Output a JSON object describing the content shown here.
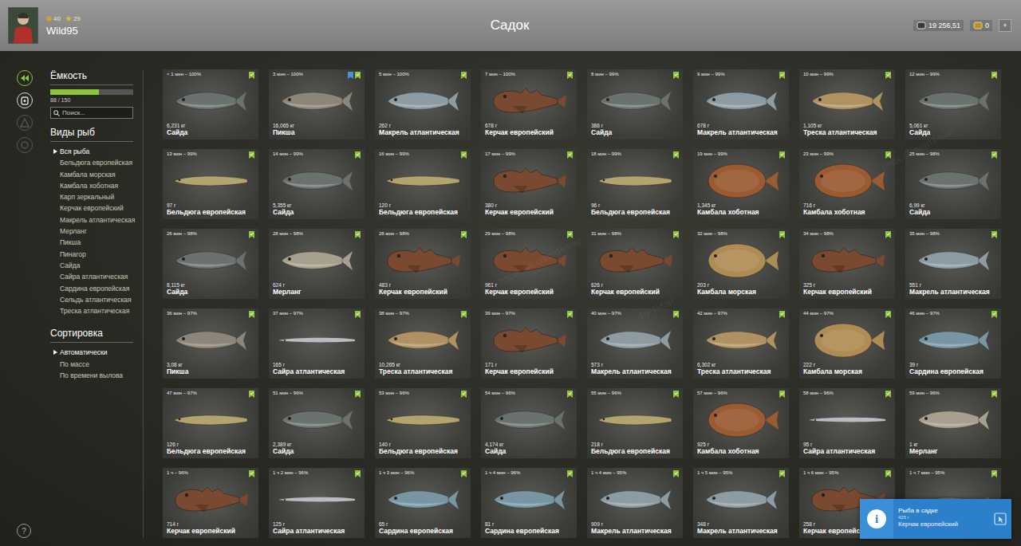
{
  "header": {
    "title": "Садок",
    "player": {
      "name": "Wild95",
      "level": "40",
      "stars": "29"
    },
    "money": "19 256,51",
    "gold": "0",
    "add_button": "+"
  },
  "side_icons": [
    {
      "selected": true
    },
    {
      "selected": false
    },
    {
      "selected": false
    },
    {
      "selected": false
    }
  ],
  "capacity": {
    "title": "Ёмкость",
    "reading": "88 / 150",
    "level": 0.587
  },
  "search": {
    "placeholder": "Поиск..."
  },
  "species": {
    "title": "Виды рыб",
    "items": [
      {
        "label": "Вся рыба",
        "selected": true
      },
      {
        "label": "Бельдюга европейская",
        "selected": false
      },
      {
        "label": "Камбала морская",
        "selected": false
      },
      {
        "label": "Камбала хоботная",
        "selected": false
      },
      {
        "label": "Карп зеркальный",
        "selected": false
      },
      {
        "label": "Керчак европейский",
        "selected": false
      },
      {
        "label": "Макрель атлантическая",
        "selected": false
      },
      {
        "label": "Мерланг",
        "selected": false
      },
      {
        "label": "Пикша",
        "selected": false
      },
      {
        "label": "Пинагор",
        "selected": false
      },
      {
        "label": "Сайда",
        "selected": false
      },
      {
        "label": "Сайра атлантическая",
        "selected": false
      },
      {
        "label": "Сардина европейская",
        "selected": false
      },
      {
        "label": "Сельдь атлантическая",
        "selected": false
      },
      {
        "label": "Треска атлантическая",
        "selected": false
      }
    ]
  },
  "sorting": {
    "title": "Сортировка",
    "items": [
      {
        "label": "Автоматически",
        "selected": true
      },
      {
        "label": "По массе",
        "selected": false
      },
      {
        "label": "По времени вылова",
        "selected": false
      }
    ]
  },
  "help": "?",
  "cards": [
    {
      "time": "< 1 мин – 100%",
      "weight": "6,231 кг",
      "name": "Сайда",
      "kind": "roundfish",
      "color": "#6b716f",
      "checked": true,
      "tagged": false
    },
    {
      "time": "3 мин – 100%",
      "weight": "16,065 кг",
      "name": "Пикша",
      "kind": "roundfish",
      "color": "#8c8579",
      "checked": true,
      "tagged": true
    },
    {
      "time": "5 мин – 100%",
      "weight": "262 г",
      "name": "Макрель атлантическая",
      "kind": "roundfish",
      "color": "#8c9ca2",
      "checked": true,
      "tagged": false
    },
    {
      "time": "7 мин – 100%",
      "weight": "678 г",
      "name": "Керчак европейский",
      "kind": "sculpin",
      "color": "#7a4a30",
      "checked": true,
      "tagged": false
    },
    {
      "time": "8 мин – 99%",
      "weight": "386 г",
      "name": "Сайда",
      "kind": "roundfish",
      "color": "#6b716f",
      "checked": true,
      "tagged": false
    },
    {
      "time": "9 мин – 99%",
      "weight": "678 г",
      "name": "Макрель атлантическая",
      "kind": "roundfish",
      "color": "#8c9ca2",
      "checked": true,
      "tagged": false
    },
    {
      "time": "10 мин – 99%",
      "weight": "1,105 кг",
      "name": "Треска атлантическая",
      "kind": "roundfish",
      "color": "#b09262",
      "checked": true,
      "tagged": false
    },
    {
      "time": "12 мин – 99%",
      "weight": "5,061 кг",
      "name": "Сайда",
      "kind": "roundfish",
      "color": "#6b716f",
      "checked": true,
      "tagged": false
    },
    {
      "time": "13 мин – 99%",
      "weight": "97 г",
      "name": "Бельдюга европейская",
      "kind": "eel",
      "color": "#b3a36e",
      "checked": true,
      "tagged": false
    },
    {
      "time": "14 мин – 99%",
      "weight": "5,355 кг",
      "name": "Сайда",
      "kind": "roundfish",
      "color": "#6b716f",
      "checked": true,
      "tagged": false
    },
    {
      "time": "16 мин – 99%",
      "weight": "120 г",
      "name": "Бельдюга европейская",
      "kind": "eel",
      "color": "#b3a36e",
      "checked": true,
      "tagged": false
    },
    {
      "time": "17 мин – 99%",
      "weight": "380 г",
      "name": "Керчак европейский",
      "kind": "sculpin",
      "color": "#7a4a30",
      "checked": true,
      "tagged": false
    },
    {
      "time": "18 мин – 99%",
      "weight": "96 г",
      "name": "Бельдюга европейская",
      "kind": "eel",
      "color": "#b3a36e",
      "checked": true,
      "tagged": false
    },
    {
      "time": "19 мин – 99%",
      "weight": "1,345 кг",
      "name": "Камбала хоботная",
      "kind": "flatfish",
      "color": "#9a5a32",
      "checked": true,
      "tagged": false
    },
    {
      "time": "23 мин – 99%",
      "weight": "716 г",
      "name": "Камбала хоботная",
      "kind": "flatfish",
      "color": "#9a5a32",
      "checked": true,
      "tagged": false
    },
    {
      "time": "25 мин – 98%",
      "weight": "6,99 кг",
      "name": "Сайда",
      "kind": "roundfish",
      "color": "#6b716f",
      "checked": true,
      "tagged": false
    },
    {
      "time": "26 мин – 98%",
      "weight": "8,115 кг",
      "name": "Сайда",
      "kind": "roundfish",
      "color": "#6b716f",
      "checked": true,
      "tagged": false
    },
    {
      "time": "28 мин – 98%",
      "weight": "624 г",
      "name": "Мерланг",
      "kind": "roundfish",
      "color": "#a8a08e",
      "checked": true,
      "tagged": false
    },
    {
      "time": "28 мин – 98%",
      "weight": "483 г",
      "name": "Керчак европейский",
      "kind": "sculpin",
      "color": "#7a4a30",
      "checked": true,
      "tagged": false
    },
    {
      "time": "29 мин – 98%",
      "weight": "961 г",
      "name": "Керчак европейский",
      "kind": "sculpin",
      "color": "#7a4a30",
      "checked": true,
      "tagged": false
    },
    {
      "time": "31 мин – 98%",
      "weight": "626 г",
      "name": "Керчак европейский",
      "kind": "sculpin",
      "color": "#7a4a30",
      "checked": true,
      "tagged": false
    },
    {
      "time": "32 мин – 98%",
      "weight": "203 г",
      "name": "Камбала морская",
      "kind": "flatfish",
      "color": "#b08c55",
      "checked": true,
      "tagged": false
    },
    {
      "time": "34 мин – 98%",
      "weight": "325 г",
      "name": "Керчак европейский",
      "kind": "sculpin",
      "color": "#7a4a30",
      "checked": true,
      "tagged": false
    },
    {
      "time": "35 мин – 98%",
      "weight": "551 г",
      "name": "Макрель атлантическая",
      "kind": "roundfish",
      "color": "#8c9ca2",
      "checked": true,
      "tagged": false
    },
    {
      "time": "36 мин – 97%",
      "weight": "3,08 кг",
      "name": "Пикша",
      "kind": "roundfish",
      "color": "#8c8579",
      "checked": true,
      "tagged": false
    },
    {
      "time": "37 мин – 97%",
      "weight": "165 г",
      "name": "Сайра атлантическая",
      "kind": "needle",
      "color": "#b9bdc2",
      "checked": true,
      "tagged": false
    },
    {
      "time": "38 мин – 97%",
      "weight": "10,265 кг",
      "name": "Треска атлантическая",
      "kind": "roundfish",
      "color": "#b09262",
      "checked": true,
      "tagged": false
    },
    {
      "time": "39 мин – 97%",
      "weight": "171 г",
      "name": "Керчак европейский",
      "kind": "sculpin",
      "color": "#7a4a30",
      "checked": true,
      "tagged": false
    },
    {
      "time": "40 мин – 97%",
      "weight": "573 г",
      "name": "Макрель атлантическая",
      "kind": "roundfish",
      "color": "#8c9ca2",
      "checked": true,
      "tagged": false
    },
    {
      "time": "42 мин – 97%",
      "weight": "6,302 кг",
      "name": "Треска атлантическая",
      "kind": "roundfish",
      "color": "#b09262",
      "checked": true,
      "tagged": false
    },
    {
      "time": "44 мин – 97%",
      "weight": "222 г",
      "name": "Камбала морская",
      "kind": "flatfish",
      "color": "#b08c55",
      "checked": true,
      "tagged": false
    },
    {
      "time": "46 мин – 97%",
      "weight": "39 г",
      "name": "Сардина европейская",
      "kind": "roundfish",
      "color": "#7895a2",
      "checked": true,
      "tagged": false
    },
    {
      "time": "47 мин – 97%",
      "weight": "126 г",
      "name": "Бельдюга европейская",
      "kind": "eel",
      "color": "#b3a36e",
      "checked": true,
      "tagged": false
    },
    {
      "time": "51 мин – 96%",
      "weight": "2,389 кг",
      "name": "Сайда",
      "kind": "roundfish",
      "color": "#6b716f",
      "checked": true,
      "tagged": false
    },
    {
      "time": "53 мин – 96%",
      "weight": "140 г",
      "name": "Бельдюга европейская",
      "kind": "eel",
      "color": "#b3a36e",
      "checked": true,
      "tagged": false
    },
    {
      "time": "54 мин – 96%",
      "weight": "4,174 кг",
      "name": "Сайда",
      "kind": "roundfish",
      "color": "#6b716f",
      "checked": true,
      "tagged": false
    },
    {
      "time": "55 мин – 96%",
      "weight": "218 г",
      "name": "Бельдюга европейская",
      "kind": "eel",
      "color": "#b3a36e",
      "checked": true,
      "tagged": false
    },
    {
      "time": "57 мин – 96%",
      "weight": "925 г",
      "name": "Камбала хоботная",
      "kind": "flatfish",
      "color": "#9a5a32",
      "checked": true,
      "tagged": false
    },
    {
      "time": "58 мин – 96%",
      "weight": "95 г",
      "name": "Сайра атлантическая",
      "kind": "needle",
      "color": "#b9bdc2",
      "checked": true,
      "tagged": false
    },
    {
      "time": "59 мин – 96%",
      "weight": "1 кг",
      "name": "Мерланг",
      "kind": "roundfish",
      "color": "#a8a08e",
      "checked": true,
      "tagged": false
    },
    {
      "time": "1 ч – 96%",
      "weight": "714 г",
      "name": "Керчак европейский",
      "kind": "sculpin",
      "color": "#7a4a30",
      "checked": true,
      "tagged": false
    },
    {
      "time": "1 ч 2 мин – 96%",
      "weight": "125 г",
      "name": "Сайра атлантическая",
      "kind": "needle",
      "color": "#b9bdc2",
      "checked": true,
      "tagged": false
    },
    {
      "time": "1 ч 3 мин – 96%",
      "weight": "65 г",
      "name": "Сардина европейская",
      "kind": "roundfish",
      "color": "#7895a2",
      "checked": true,
      "tagged": false
    },
    {
      "time": "1 ч 4 мин – 96%",
      "weight": "81 г",
      "name": "Сардина европейская",
      "kind": "roundfish",
      "color": "#7895a2",
      "checked": true,
      "tagged": false
    },
    {
      "time": "1 ч 4 мин – 95%",
      "weight": "909 г",
      "name": "Макрель атлантическая",
      "kind": "roundfish",
      "color": "#8c9ca2",
      "checked": true,
      "tagged": false
    },
    {
      "time": "1 ч 5 мин – 95%",
      "weight": "348 г",
      "name": "Макрель атлантическая",
      "kind": "roundfish",
      "color": "#8c9ca2",
      "checked": true,
      "tagged": false
    },
    {
      "time": "1 ч 6 мин – 95%",
      "weight": "258 г",
      "name": "Керчак европейский",
      "kind": "sculpin",
      "color": "#7a4a30",
      "checked": true,
      "tagged": false
    },
    {
      "time": "1 ч 7 мин – 95%",
      "kind": "roundfish",
      "color": "#6b716f",
      "checked": true,
      "tagged": false
    }
  ],
  "notification": {
    "icon": "i",
    "title": "Рыба в садке",
    "detail": "425 г",
    "fish": "Керчак европейский"
  },
  "watermarks": [
    "RF4Map",
    "https://vk.com/rf4map",
    "https://t.me/rf4map"
  ]
}
